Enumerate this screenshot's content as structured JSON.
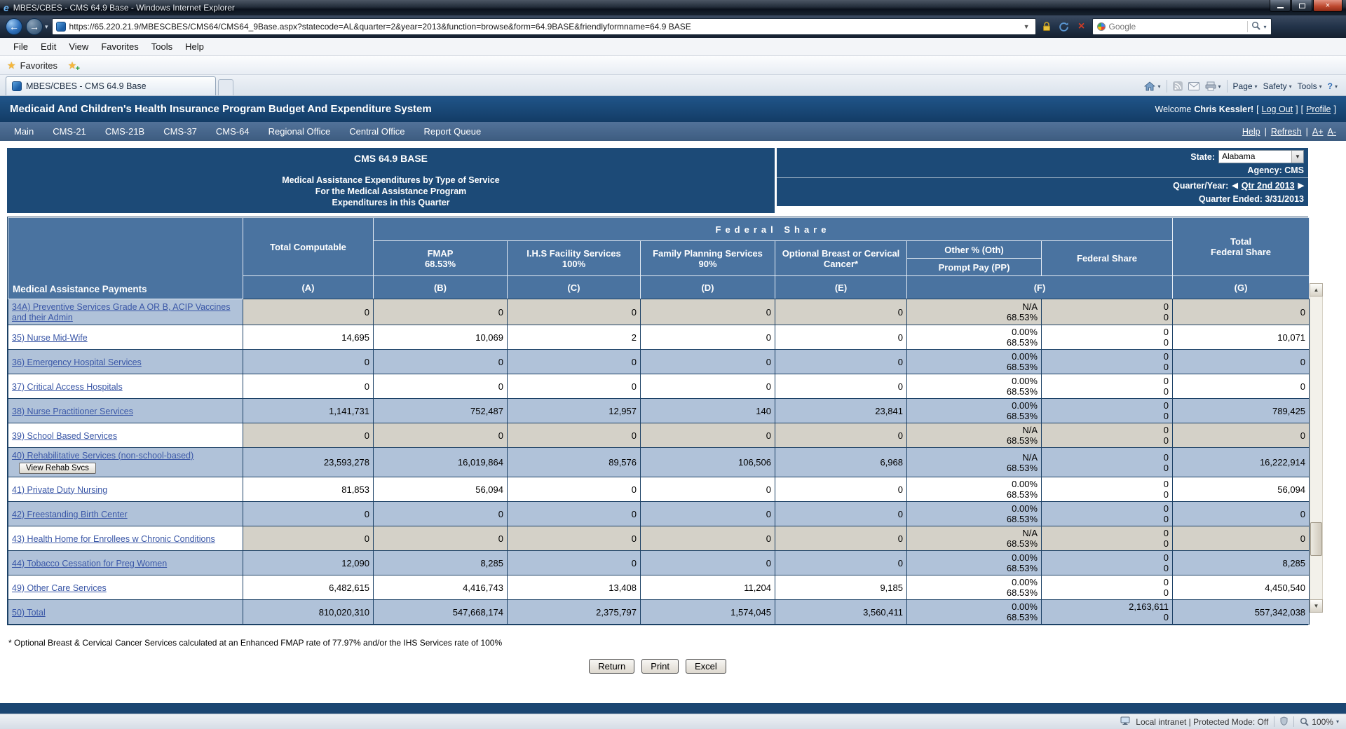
{
  "window": {
    "title": "MBES/CBES - CMS 64.9 Base - Windows Internet Explorer",
    "url": "https://65.220.21.9/MBESCBES/CMS64/CMS64_9Base.aspx?statecode=AL&quarter=2&year=2013&function=browse&form=64.9BASE&friendlyformname=64.9 BASE",
    "search_engine": "Google",
    "menu": [
      "File",
      "Edit",
      "View",
      "Favorites",
      "Tools",
      "Help"
    ],
    "favorites_label": "Favorites",
    "tab_title": "MBES/CBES - CMS 64.9 Base",
    "command_bar": {
      "page": "Page",
      "safety": "Safety",
      "tools": "Tools",
      "help": "?"
    },
    "status": {
      "zone": "Local intranet | Protected Mode: Off",
      "zoom": "100%"
    }
  },
  "icons": {
    "back": "←",
    "forward": "→",
    "caret_down": "▾",
    "dropdown": "▼",
    "tri_up": "▲",
    "tri_down": "▼",
    "prev": "◀",
    "next": "▶",
    "close": "×",
    "stop": "×",
    "minimize": "–",
    "star": "★",
    "plus": "+",
    "help": "?"
  },
  "app": {
    "title": "Medicaid And Children's Health Insurance Program Budget And Expenditure System",
    "welcome_prefix": "Welcome",
    "user": "Chris Kessler!",
    "bracket_open": "[",
    "bracket_close": "]",
    "logout": "Log Out",
    "profile": "Profile",
    "nav": [
      "Main",
      "CMS-21",
      "CMS-21B",
      "CMS-37",
      "CMS-64",
      "Regional Office",
      "Central Office",
      "Report Queue"
    ],
    "nav_right": {
      "help": "Help",
      "refresh": "Refresh",
      "font_plus": "A+",
      "font_minus": "A-",
      "divider": "|"
    }
  },
  "form": {
    "title": "CMS 64.9 BASE",
    "subtitle1": "Medical Assistance Expenditures by Type of Service",
    "subtitle2": "For the Medical Assistance Program",
    "subtitle3": "Expenditures in this Quarter",
    "state_label": "State:",
    "state_value": "Alabama",
    "agency": "Agency: CMS",
    "quarter_label": "Quarter/Year:",
    "quarter_value": "Qtr 2nd 2013",
    "quarter_ended": "Quarter Ended: 3/31/2013",
    "footnote": "* Optional Breast & Cervical Cancer Services calculated at an Enhanced FMAP rate of 77.97% and/or the IHS Services rate of 100%",
    "buttons": {
      "return": "Return",
      "print": "Print",
      "excel": "Excel"
    }
  },
  "table": {
    "banner": "Federal Share",
    "row_header": "Medical Assistance Payments",
    "col_total_computable": "Total Computable",
    "col_fmap_title": "FMAP",
    "col_fmap_rate": "68.53%",
    "col_ihs_title": "I.H.S Facility Services",
    "col_ihs_rate": "100%",
    "col_fp_title": "Family Planning Services",
    "col_fp_rate": "90%",
    "col_obc": "Optional Breast or Cervical Cancer*",
    "col_oth": "Other % (Oth)",
    "col_pp": "Prompt Pay (PP)",
    "col_fed_share": "Federal Share",
    "col_total_fed_1": "Total",
    "col_total_fed_2": "Federal Share",
    "letters": [
      "(A)",
      "(B)",
      "(C)",
      "(D)",
      "(E)",
      "(F)",
      "(G)"
    ],
    "rows": [
      {
        "label": "34A) Preventive Services Grade A OR B, ACIP Vaccines and their Admin",
        "a": "0",
        "b": "0",
        "c": "0",
        "d": "0",
        "e": "0",
        "oth": "N/A",
        "oth_rate": "68.53%",
        "fs1": "0",
        "fs2": "0",
        "g": "0",
        "stripe": true,
        "gray": true
      },
      {
        "label": "35) Nurse Mid-Wife",
        "a": "14,695",
        "b": "10,069",
        "c": "2",
        "d": "0",
        "e": "0",
        "oth": "0.00%",
        "oth_rate": "68.53%",
        "fs1": "0",
        "fs2": "0",
        "g": "10,071",
        "stripe": false,
        "gray": false
      },
      {
        "label": "36) Emergency Hospital Services",
        "a": "0",
        "b": "0",
        "c": "0",
        "d": "0",
        "e": "0",
        "oth": "0.00%",
        "oth_rate": "68.53%",
        "fs1": "0",
        "fs2": "0",
        "g": "0",
        "stripe": true,
        "gray": false
      },
      {
        "label": "37) Critical Access Hospitals",
        "a": "0",
        "b": "0",
        "c": "0",
        "d": "0",
        "e": "0",
        "oth": "0.00%",
        "oth_rate": "68.53%",
        "fs1": "0",
        "fs2": "0",
        "g": "0",
        "stripe": false,
        "gray": false
      },
      {
        "label": "38) Nurse Practitioner Services",
        "a": "1,141,731",
        "b": "752,487",
        "c": "12,957",
        "d": "140",
        "e": "23,841",
        "oth": "0.00%",
        "oth_rate": "68.53%",
        "fs1": "0",
        "fs2": "0",
        "g": "789,425",
        "stripe": true,
        "gray": false
      },
      {
        "label": "39) School Based Services",
        "a": "0",
        "b": "0",
        "c": "0",
        "d": "0",
        "e": "0",
        "oth": "N/A",
        "oth_rate": "68.53%",
        "fs1": "0",
        "fs2": "0",
        "g": "0",
        "stripe": false,
        "gray": true
      },
      {
        "label": "40) Rehabilitative Services (non-school-based)",
        "button": "View Rehab Svcs",
        "a": "23,593,278",
        "b": "16,019,864",
        "c": "89,576",
        "d": "106,506",
        "e": "6,968",
        "oth": "N/A",
        "oth_rate": "68.53%",
        "fs1": "0",
        "fs2": "0",
        "g": "16,222,914",
        "stripe": true,
        "gray": false
      },
      {
        "label": "41) Private Duty Nursing",
        "a": "81,853",
        "b": "56,094",
        "c": "0",
        "d": "0",
        "e": "0",
        "oth": "0.00%",
        "oth_rate": "68.53%",
        "fs1": "0",
        "fs2": "0",
        "g": "56,094",
        "stripe": false,
        "gray": false
      },
      {
        "label": "42) Freestanding Birth Center",
        "a": "0",
        "b": "0",
        "c": "0",
        "d": "0",
        "e": "0",
        "oth": "0.00%",
        "oth_rate": "68.53%",
        "fs1": "0",
        "fs2": "0",
        "g": "0",
        "stripe": true,
        "gray": false
      },
      {
        "label": "43) Health Home for Enrollees w Chronic Conditions",
        "a": "0",
        "b": "0",
        "c": "0",
        "d": "0",
        "e": "0",
        "oth": "N/A",
        "oth_rate": "68.53%",
        "fs1": "0",
        "fs2": "0",
        "g": "0",
        "stripe": false,
        "gray": true
      },
      {
        "label": "44) Tobacco Cessation for Preg Women",
        "a": "12,090",
        "b": "8,285",
        "c": "0",
        "d": "0",
        "e": "0",
        "oth": "0.00%",
        "oth_rate": "68.53%",
        "fs1": "0",
        "fs2": "0",
        "g": "8,285",
        "stripe": true,
        "gray": false
      },
      {
        "label": "49) Other Care Services",
        "a": "6,482,615",
        "b": "4,416,743",
        "c": "13,408",
        "d": "11,204",
        "e": "9,185",
        "oth": "0.00%",
        "oth_rate": "68.53%",
        "fs1": "0",
        "fs2": "0",
        "g": "4,450,540",
        "stripe": false,
        "gray": false
      },
      {
        "label": "50) Total",
        "a": "810,020,310",
        "b": "547,668,174",
        "c": "2,375,797",
        "d": "1,574,045",
        "e": "3,560,411",
        "oth": "0.00%",
        "oth_rate": "68.53%",
        "fs1": "2,163,611",
        "fs2": "0",
        "g": "557,342,038",
        "stripe": true,
        "gray": false,
        "total": true
      }
    ]
  }
}
